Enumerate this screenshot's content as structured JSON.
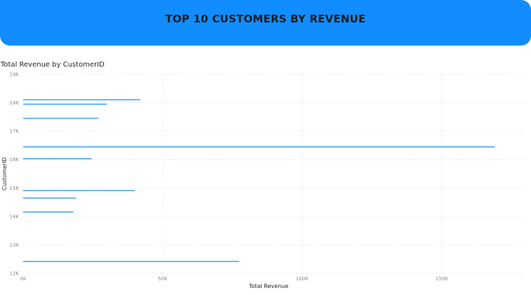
{
  "banner": {
    "title": "TOP 10 CUSTOMERS BY REVENUE"
  },
  "visual": {
    "title": "Total Revenue by CustomerID"
  },
  "colors": {
    "banner": "#118dff",
    "bar": "#118dff",
    "grid": "#e1dfdd"
  },
  "chart_data": {
    "type": "bar",
    "orientation": "horizontal",
    "title": "Total Revenue by CustomerID",
    "xlabel": "Total Revenue",
    "ylabel": "CustomerID",
    "xlim": [
      0,
      180000
    ],
    "ylim": [
      12000,
      19000
    ],
    "x_ticks": [
      0,
      50000,
      100000,
      150000
    ],
    "x_tick_labels": [
      "0K",
      "50K",
      "100K",
      "150K"
    ],
    "y_ticks": [
      19000,
      18000,
      17000,
      16000,
      15000,
      14000,
      13000,
      12000
    ],
    "y_tick_labels": [
      "19K",
      "18K",
      "17K",
      "16K",
      "15K",
      "14K",
      "13K",
      "12K"
    ],
    "grid": true,
    "categories": [
      18102,
      17949,
      17450,
      16446,
      16029,
      14911,
      14646,
      14156,
      12415
    ],
    "values": [
      42000,
      30000,
      27000,
      169000,
      24500,
      40000,
      19000,
      18000,
      77500
    ]
  }
}
